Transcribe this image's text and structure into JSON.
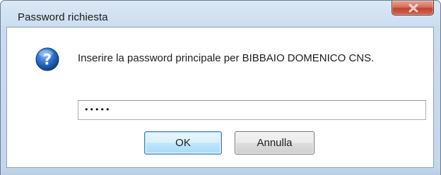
{
  "window": {
    "title": "Password richiesta",
    "close_label": "x"
  },
  "dialog": {
    "icon": "question-icon",
    "prompt": "Inserire la password principale per BIBBAIO DOMENICO CNS.",
    "password_value": "•••••",
    "ok_label": "OK",
    "cancel_label": "Annulla"
  },
  "colors": {
    "titlebar": "#c9dcef",
    "close_button": "#c1432e",
    "default_button_border": "#3c7fb1",
    "icon_blue": "#2a6fc9"
  }
}
